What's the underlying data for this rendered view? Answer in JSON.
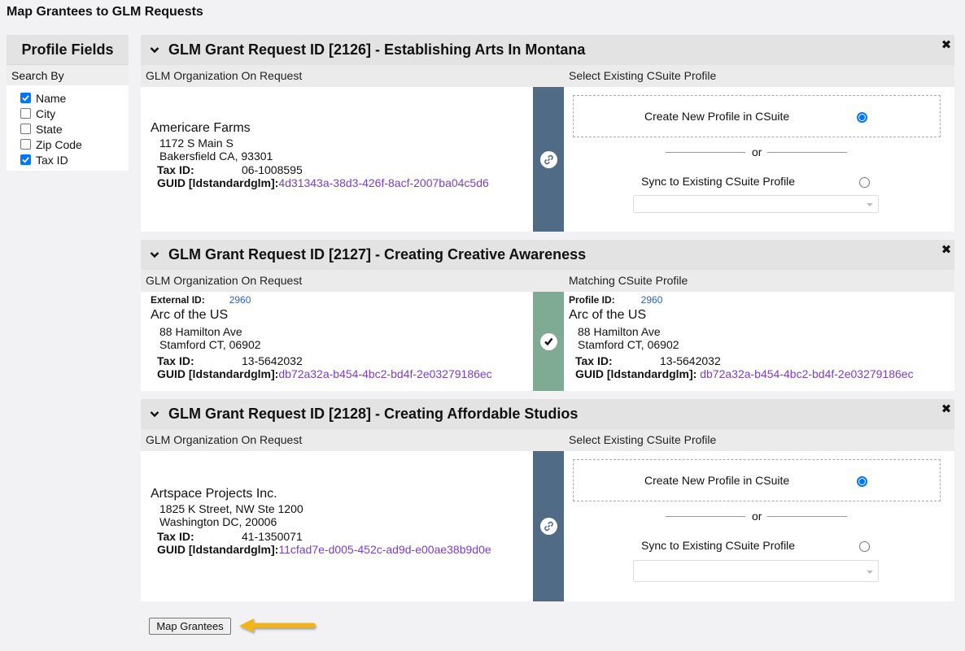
{
  "page": {
    "title": "Map Grantees to GLM Requests"
  },
  "sidebar": {
    "title": "Profile Fields",
    "subtitle": "Search By",
    "fields": [
      {
        "label": "Name",
        "checked": true
      },
      {
        "label": "City",
        "checked": false
      },
      {
        "label": "State",
        "checked": false
      },
      {
        "label": "Zip Code",
        "checked": false
      },
      {
        "label": "Tax ID",
        "checked": true
      }
    ]
  },
  "requests": [
    {
      "title": "GLM Grant Request ID [2126] - Establishing Arts In Montana",
      "left_header": "GLM Organization On Request",
      "right_header": "Select Existing CSuite Profile",
      "status": "unmatched",
      "org": {
        "name": "Americare Farms",
        "address1": "1172 S Main S",
        "address2": "Bakersfield CA,  93301",
        "tax_label": "Tax ID:",
        "tax_id": "06-1008595",
        "guid_label": "GUID [ldstandardglm]:",
        "guid": "4d31343a-38d3-426f-8acf-2007ba04c5d6"
      },
      "create_label": "Create New Profile in CSuite",
      "or_label": "or",
      "sync_label": "Sync to Existing CSuite Profile",
      "selected_option": "create"
    },
    {
      "title": "GLM Grant Request ID [2127] - Creating Creative Awareness",
      "left_header": "GLM Organization On Request",
      "right_header": "Matching CSuite Profile",
      "status": "matched",
      "org": {
        "ext_label": "External ID:",
        "ext_id": "2960",
        "name": "Arc of the US",
        "address1": "88 Hamilton Ave",
        "address2": "Stamford CT,  06902",
        "tax_label": "Tax ID:",
        "tax_id": "13-5642032",
        "guid_label": "GUID [ldstandardglm]:",
        "guid": "db72a32a-b454-4bc2-bd4f-2e03279186ec"
      },
      "profile": {
        "id_label": "Profile ID:",
        "id": "2960",
        "name": "Arc of the US",
        "address1": "88 Hamilton Ave",
        "address2": "Stamford CT,  06902",
        "tax_label": "Tax ID:",
        "tax_id": "13-5642032",
        "guid_label": "GUID [ldstandardglm]:",
        "guid": "db72a32a-b454-4bc2-bd4f-2e03279186ec"
      }
    },
    {
      "title": "GLM Grant Request ID [2128] - Creating Affordable Studios",
      "left_header": "GLM Organization On Request",
      "right_header": "Select Existing CSuite Profile",
      "status": "unmatched",
      "org": {
        "name": "Artspace Projects Inc.",
        "address1": "1825 K Street, NW Ste 1200",
        "address2": "Washington DC,  20006",
        "tax_label": "Tax ID:",
        "tax_id": "41-1350071",
        "guid_label": "GUID [ldstandardglm]:",
        "guid": "11cfad7e-d005-452c-ad9d-e00ae38b9d0e"
      },
      "create_label": "Create New Profile in CSuite",
      "or_label": "or",
      "sync_label": "Sync to Existing CSuite Profile",
      "selected_option": "create"
    }
  ],
  "footer": {
    "map_button_label": "Map Grantees"
  },
  "icons": {
    "collapse": "chevron-down-icon",
    "close": "close-icon",
    "link": "link-icon",
    "matched": "checkmark-icon",
    "annotation": "arrow-left-icon"
  },
  "colors": {
    "unmatched_bar": "#506b86",
    "matched_bar": "#7faa93",
    "guid": "#7a3fc7",
    "accent": "#0075ff",
    "annotation_arrow": "#f2b418"
  }
}
